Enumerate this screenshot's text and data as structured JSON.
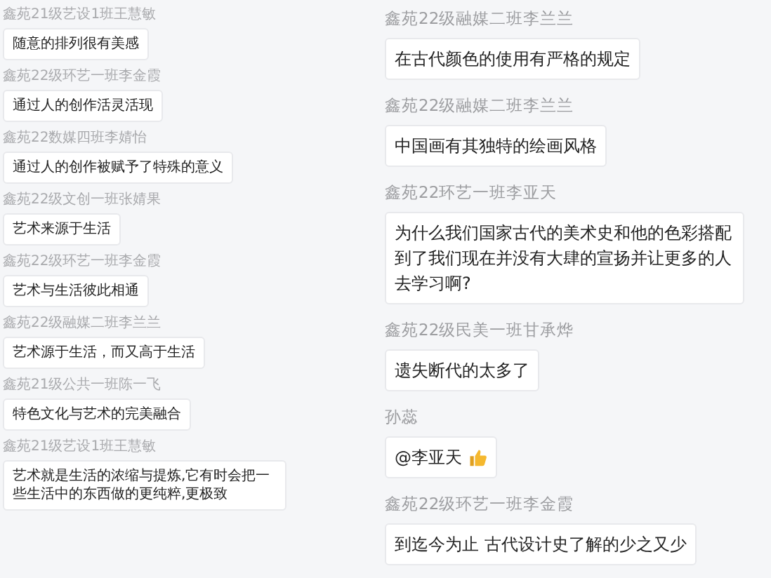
{
  "columns": [
    {
      "messages": [
        {
          "sender": "鑫苑21级艺设1班王慧敏",
          "text": "随意的排列很有美感",
          "kind": "text"
        },
        {
          "sender": "鑫苑22级环艺一班李金霞",
          "text": "通过人的创作活灵活现",
          "kind": "text"
        },
        {
          "sender": "鑫苑22数媒四班李婧怡",
          "text": "通过人的创作被赋予了特殊的意义",
          "kind": "text"
        },
        {
          "sender": "鑫苑22级文创一班张婧果",
          "text": "艺术来源于生活",
          "kind": "text"
        },
        {
          "sender": "鑫苑22级环艺一班李金霞",
          "text": "艺术与生活彼此相通",
          "kind": "text"
        },
        {
          "sender": "鑫苑22级融媒二班李兰兰",
          "text": "艺术源于生活，而又高于生活",
          "kind": "text"
        },
        {
          "sender": "鑫苑21级公共一班陈一飞",
          "text": "特色文化与艺术的完美融合",
          "kind": "text"
        },
        {
          "sender": "鑫苑21级艺设1班王慧敏",
          "text": "艺术就是生活的浓缩与提炼,它有时会把一些生活中的东西做的更纯粹,更极致",
          "kind": "text"
        }
      ]
    },
    {
      "messages": [
        {
          "sender": "鑫苑22级融媒二班李兰兰",
          "text": "在古代颜色的使用有严格的规定",
          "kind": "text"
        },
        {
          "sender": "鑫苑22级融媒二班李兰兰",
          "text": "中国画有其独特的绘画风格",
          "kind": "text"
        },
        {
          "sender": "鑫苑22环艺一班李亚天",
          "text": "为什么我们国家古代的美术史和他的色彩搭配到了我们现在并没有大肆的宣扬并让更多的人去学习啊?",
          "kind": "text"
        },
        {
          "sender": "鑫苑22级民美一班甘承烨",
          "text": "遗失断代的太多了",
          "kind": "text"
        },
        {
          "sender": "孙蕊",
          "text": "@李亚天",
          "kind": "thumbs_up"
        },
        {
          "sender": "鑫苑22级环艺一班李金霞",
          "text": "到迄今为止 古代设计史了解的少之又少",
          "kind": "text"
        }
      ]
    }
  ]
}
